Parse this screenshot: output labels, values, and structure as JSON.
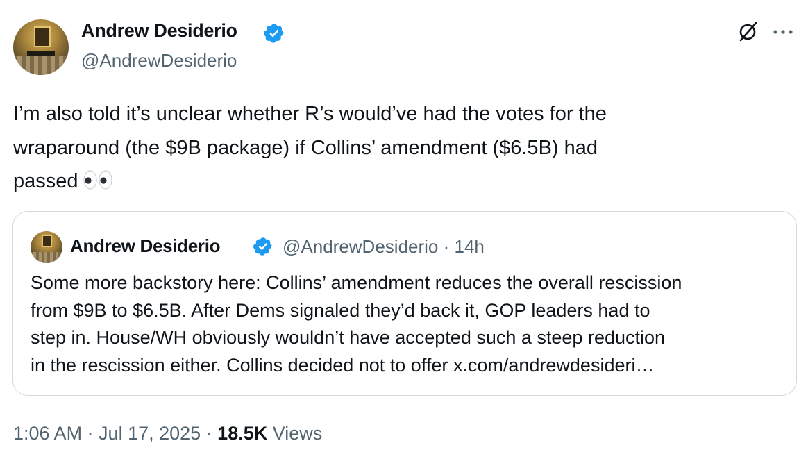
{
  "author": {
    "display_name": "Andrew Desiderio",
    "handle": "@AndrewDesiderio"
  },
  "icons": {
    "verified": "verified-badge-icon",
    "grok": "grok-icon",
    "more": "more-options-icon",
    "emoji": "eyes-emoji"
  },
  "colors": {
    "verified_blue": "#1d9bf0",
    "secondary_text": "#536471",
    "primary_text": "#0f1419",
    "border": "#cfd9de"
  },
  "tweet": {
    "text": "I’m also told it’s unclear whether R’s would’ve had the votes for the\nwraparound (the $9B package) if Collins’ amendment ($6.5B) had\npassed"
  },
  "quote": {
    "display_name": "Andrew Desiderio",
    "meta": "@AndrewDesiderio · 14h",
    "text": "Some more backstory here: Collins’ amendment reduces the overall rescission\nfrom $9B to $6.5B. After Dems signaled they’d back it, GOP leaders had to\nstep in. House/WH obviously wouldn’t have accepted such a steep reduction\nin the rescission either. Collins decided not to offer x.com/andrewdesideri…"
  },
  "footer": {
    "time": "1:06 AM · Jul 17, 2025 · ",
    "views_count": "18.5K",
    "views_label": " Views"
  }
}
